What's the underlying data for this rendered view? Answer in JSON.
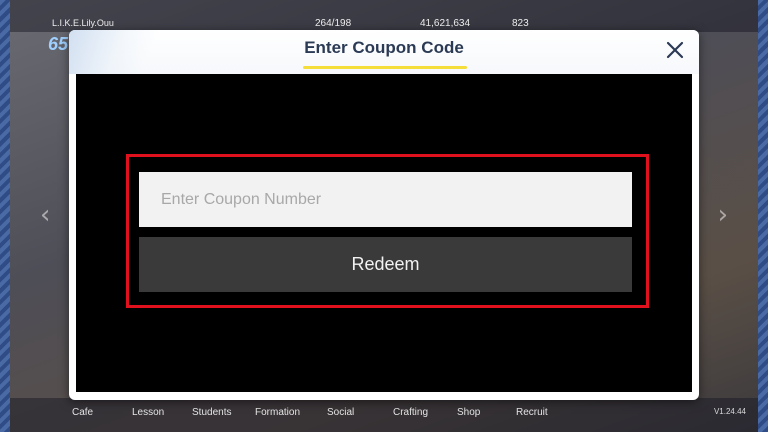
{
  "dialog": {
    "title": "Enter Coupon Code",
    "close_icon": "close-icon",
    "input_placeholder": "Enter Coupon Number",
    "input_value": "",
    "redeem_label": "Redeem",
    "highlight_color": "#e0101c",
    "title_underline_color": "#f5de39"
  },
  "background_hud": {
    "nickname": "L.I.K.E.Lily.Ouu",
    "level": "65",
    "ap": "264/198",
    "credits": "41,621,634",
    "gems": "823",
    "nav_items": [
      "Cafe",
      "Lesson",
      "Students",
      "Formation",
      "Social",
      "Crafting",
      "Shop",
      "Recruit"
    ],
    "version": "V1.24.44"
  }
}
